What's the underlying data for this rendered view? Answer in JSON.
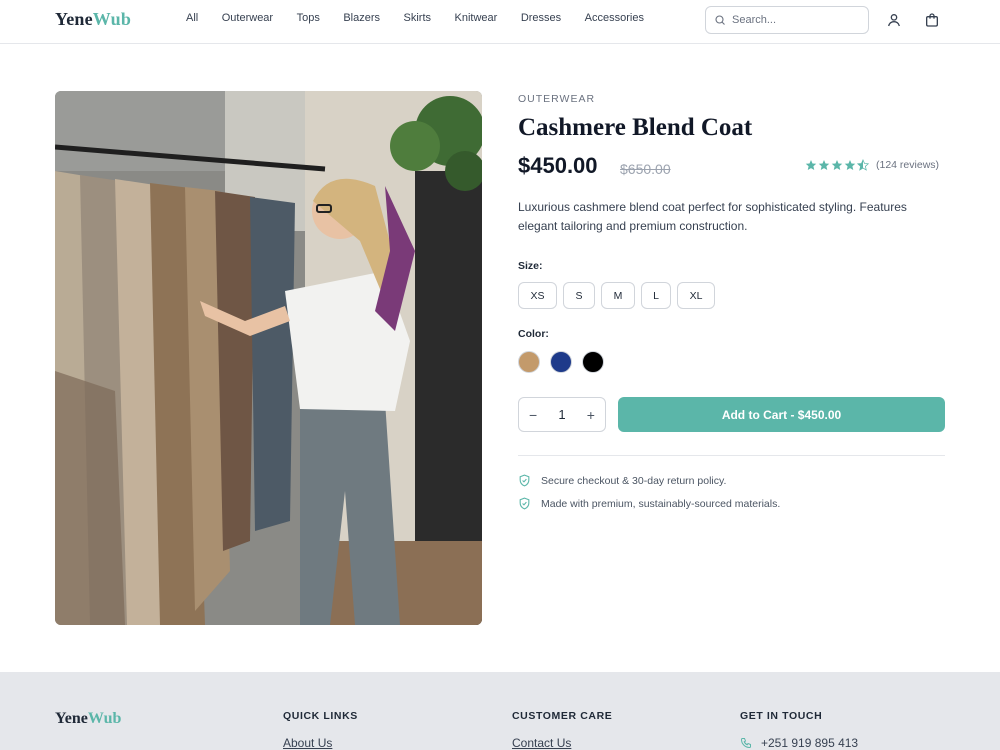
{
  "brand": {
    "name_part1": "Yene",
    "name_part2": "Wub",
    "accent_color": "#5bb6a9"
  },
  "nav": [
    "All",
    "Outerwear",
    "Tops",
    "Blazers",
    "Skirts",
    "Knitwear",
    "Dresses",
    "Accessories"
  ],
  "search": {
    "placeholder": "Search..."
  },
  "header_icons": [
    "user-icon",
    "shopping-bag-icon"
  ],
  "product": {
    "category": "OUTERWEAR",
    "title": "Cashmere Blend Coat",
    "price": "$450.00",
    "old_price": "$650.00",
    "rating": 4.5,
    "reviews": "(124 reviews)",
    "description": "Luxurious cashmere blend coat perfect for sophisticated styling. Features elegant tailoring and premium construction.",
    "size_label": "Size:",
    "sizes": [
      "XS",
      "S",
      "M",
      "L",
      "XL"
    ],
    "color_label": "Color:",
    "colors": [
      "#c39a6b",
      "#1e3a8a",
      "#000000"
    ],
    "quantity": "1",
    "minus": "−",
    "plus": "+",
    "add_to_cart": "Add to Cart - $450.00",
    "features": [
      "Secure checkout & 30-day return policy.",
      "Made with premium, sustainably-sourced materials."
    ]
  },
  "footer": {
    "quick_links_title": "QUICK LINKS",
    "quick_links_first": "About Us",
    "customer_care_title": "CUSTOMER CARE",
    "customer_care_first": "Contact Us",
    "get_in_touch_title": "GET IN TOUCH",
    "phone": "+251 919 895 413"
  }
}
